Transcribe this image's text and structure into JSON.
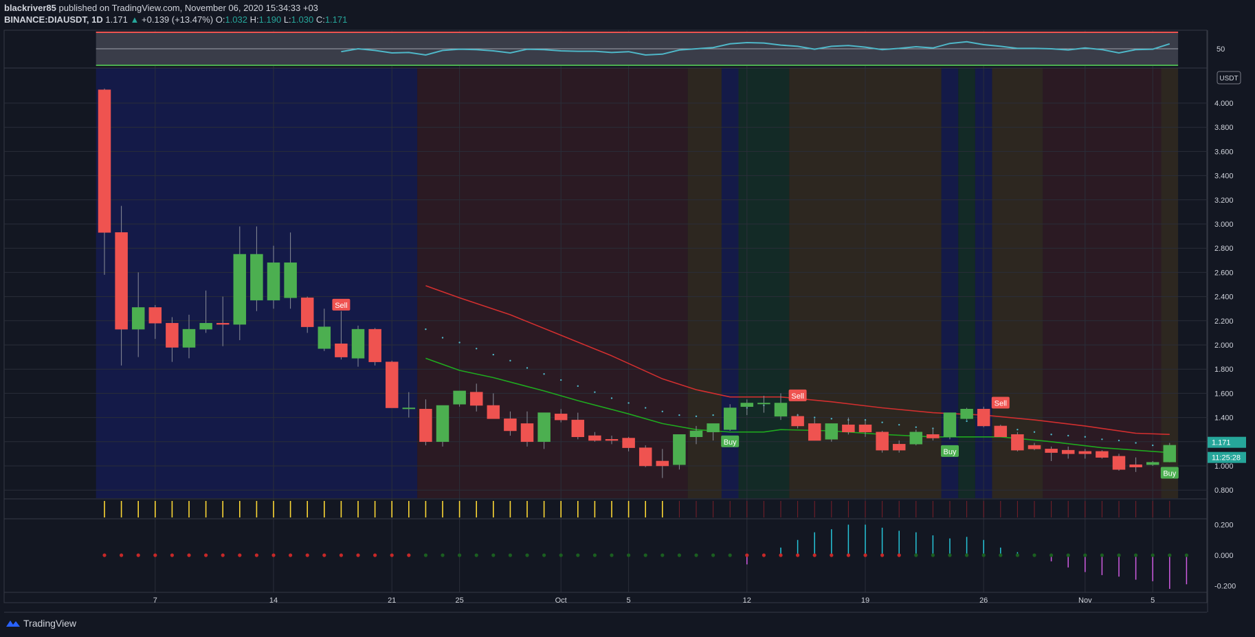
{
  "header": {
    "author": "blackriver85",
    "published_text": "published on TradingView.com, November 06, 2020 15:34:33 +03",
    "symbol": "BINANCE:DIAUSDT, 1D",
    "last": "1.171",
    "change": "+0.139 (+13.47%)",
    "o_label": "O:",
    "o_val": "1.032",
    "h_label": "H:",
    "h_val": "1.190",
    "l_label": "L:",
    "l_val": "1.030",
    "c_label": "C:",
    "c_val": "1.171"
  },
  "footer": {
    "brand": "TradingView"
  },
  "colors": {
    "bull": "#26a69a",
    "bear": "#ef5350",
    "bg": "#131722",
    "grid": "#2a2e39",
    "text": "#d1d4dc"
  },
  "chart_data": {
    "type": "candlestick",
    "currency_label": "USDT",
    "ylim": [
      0.6,
      4.3
    ],
    "y_ticks": [
      "0.800",
      "1.000",
      "1.200",
      "1.400",
      "1.600",
      "1.800",
      "2.000",
      "2.200",
      "2.400",
      "2.600",
      "2.800",
      "3.000",
      "3.200",
      "3.400",
      "3.600",
      "3.800",
      "4.000"
    ],
    "x_labels": [
      {
        "i": 3,
        "label": "7"
      },
      {
        "i": 10,
        "label": "14"
      },
      {
        "i": 17,
        "label": "21"
      },
      {
        "i": 21,
        "label": "25"
      },
      {
        "i": 27,
        "label": "Oct"
      },
      {
        "i": 31,
        "label": "5"
      },
      {
        "i": 38,
        "label": "12"
      },
      {
        "i": 45,
        "label": "19"
      },
      {
        "i": 52,
        "label": "26"
      },
      {
        "i": 58,
        "label": "Nov"
      },
      {
        "i": 62,
        "label": "5"
      }
    ],
    "candles": [
      {
        "o": 4.11,
        "h": 4.12,
        "l": 2.58,
        "c": 2.93
      },
      {
        "o": 2.93,
        "h": 3.15,
        "l": 1.83,
        "c": 2.13
      },
      {
        "o": 2.13,
        "h": 2.6,
        "l": 1.9,
        "c": 2.31
      },
      {
        "o": 2.31,
        "h": 2.33,
        "l": 2.05,
        "c": 2.18
      },
      {
        "o": 2.18,
        "h": 2.23,
        "l": 1.86,
        "c": 1.98
      },
      {
        "o": 1.98,
        "h": 2.25,
        "l": 1.89,
        "c": 2.13
      },
      {
        "o": 2.13,
        "h": 2.45,
        "l": 2.1,
        "c": 2.18
      },
      {
        "o": 2.18,
        "h": 2.4,
        "l": 1.99,
        "c": 2.17
      },
      {
        "o": 2.17,
        "h": 2.98,
        "l": 2.04,
        "c": 2.75
      },
      {
        "o": 2.37,
        "h": 2.98,
        "l": 2.28,
        "c": 2.75
      },
      {
        "o": 2.37,
        "h": 2.82,
        "l": 2.3,
        "c": 2.68
      },
      {
        "o": 2.39,
        "h": 2.93,
        "l": 2.3,
        "c": 2.68
      },
      {
        "o": 2.39,
        "h": 2.4,
        "l": 2.1,
        "c": 2.15
      },
      {
        "o": 1.97,
        "h": 2.3,
        "l": 1.95,
        "c": 2.15
      },
      {
        "o": 2.01,
        "h": 2.28,
        "l": 1.88,
        "c": 1.9
      },
      {
        "o": 1.89,
        "h": 2.16,
        "l": 1.82,
        "c": 2.13
      },
      {
        "o": 2.13,
        "h": 2.14,
        "l": 1.83,
        "c": 1.86
      },
      {
        "o": 1.86,
        "h": 1.87,
        "l": 1.48,
        "c": 1.48
      },
      {
        "o": 1.48,
        "h": 1.61,
        "l": 1.4,
        "c": 1.48
      },
      {
        "o": 1.47,
        "h": 1.55,
        "l": 1.17,
        "c": 1.2
      },
      {
        "o": 1.2,
        "h": 1.5,
        "l": 1.16,
        "c": 1.5
      },
      {
        "o": 1.51,
        "h": 1.62,
        "l": 1.49,
        "c": 1.62
      },
      {
        "o": 1.61,
        "h": 1.68,
        "l": 1.45,
        "c": 1.5
      },
      {
        "o": 1.5,
        "h": 1.6,
        "l": 1.4,
        "c": 1.39
      },
      {
        "o": 1.39,
        "h": 1.45,
        "l": 1.25,
        "c": 1.29
      },
      {
        "o": 1.35,
        "h": 1.45,
        "l": 1.16,
        "c": 1.2
      },
      {
        "o": 1.2,
        "h": 1.44,
        "l": 1.14,
        "c": 1.44
      },
      {
        "o": 1.43,
        "h": 1.47,
        "l": 1.36,
        "c": 1.38
      },
      {
        "o": 1.38,
        "h": 1.44,
        "l": 1.22,
        "c": 1.24
      },
      {
        "o": 1.25,
        "h": 1.28,
        "l": 1.2,
        "c": 1.21
      },
      {
        "o": 1.22,
        "h": 1.25,
        "l": 1.18,
        "c": 1.21
      },
      {
        "o": 1.23,
        "h": 1.24,
        "l": 1.12,
        "c": 1.15
      },
      {
        "o": 1.15,
        "h": 1.17,
        "l": 0.99,
        "c": 1.0
      },
      {
        "o": 1.04,
        "h": 1.14,
        "l": 0.9,
        "c": 1.0
      },
      {
        "o": 1.01,
        "h": 1.26,
        "l": 0.97,
        "c": 1.26
      },
      {
        "o": 1.24,
        "h": 1.33,
        "l": 1.18,
        "c": 1.29
      },
      {
        "o": 1.28,
        "h": 1.35,
        "l": 1.21,
        "c": 1.35
      },
      {
        "o": 1.3,
        "h": 1.51,
        "l": 1.29,
        "c": 1.48
      },
      {
        "o": 1.49,
        "h": 1.55,
        "l": 1.42,
        "c": 1.52
      },
      {
        "o": 1.52,
        "h": 1.58,
        "l": 1.44,
        "c": 1.52
      },
      {
        "o": 1.41,
        "h": 1.6,
        "l": 1.38,
        "c": 1.52
      },
      {
        "o": 1.41,
        "h": 1.43,
        "l": 1.31,
        "c": 1.33
      },
      {
        "o": 1.35,
        "h": 1.39,
        "l": 1.21,
        "c": 1.21
      },
      {
        "o": 1.22,
        "h": 1.35,
        "l": 1.2,
        "c": 1.35
      },
      {
        "o": 1.34,
        "h": 1.4,
        "l": 1.26,
        "c": 1.28
      },
      {
        "o": 1.34,
        "h": 1.38,
        "l": 1.24,
        "c": 1.28
      },
      {
        "o": 1.28,
        "h": 1.29,
        "l": 1.11,
        "c": 1.13
      },
      {
        "o": 1.18,
        "h": 1.21,
        "l": 1.11,
        "c": 1.13
      },
      {
        "o": 1.18,
        "h": 1.3,
        "l": 1.17,
        "c": 1.28
      },
      {
        "o": 1.26,
        "h": 1.31,
        "l": 1.21,
        "c": 1.23
      },
      {
        "o": 1.24,
        "h": 1.44,
        "l": 1.22,
        "c": 1.44
      },
      {
        "o": 1.39,
        "h": 1.48,
        "l": 1.38,
        "c": 1.47
      },
      {
        "o": 1.47,
        "h": 1.49,
        "l": 1.32,
        "c": 1.33
      },
      {
        "o": 1.33,
        "h": 1.34,
        "l": 1.24,
        "c": 1.24
      },
      {
        "o": 1.26,
        "h": 1.28,
        "l": 1.12,
        "c": 1.13
      },
      {
        "o": 1.17,
        "h": 1.19,
        "l": 1.13,
        "c": 1.14
      },
      {
        "o": 1.14,
        "h": 1.16,
        "l": 1.04,
        "c": 1.11
      },
      {
        "o": 1.13,
        "h": 1.16,
        "l": 1.06,
        "c": 1.1
      },
      {
        "o": 1.12,
        "h": 1.14,
        "l": 1.06,
        "c": 1.1
      },
      {
        "o": 1.12,
        "h": 1.13,
        "l": 1.06,
        "c": 1.07
      },
      {
        "o": 1.08,
        "h": 1.1,
        "l": 0.96,
        "c": 0.97
      },
      {
        "o": 1.01,
        "h": 1.07,
        "l": 0.95,
        "c": 0.99
      },
      {
        "o": 1.01,
        "h": 1.04,
        "l": 1.0,
        "c": 1.03
      },
      {
        "o": 1.032,
        "h": 1.19,
        "l": 1.03,
        "c": 1.171
      }
    ],
    "sma_red": [
      [
        19,
        2.49
      ],
      [
        21,
        2.39
      ],
      [
        24,
        2.25
      ],
      [
        27,
        2.08
      ],
      [
        30,
        1.91
      ],
      [
        33,
        1.72
      ],
      [
        35,
        1.63
      ],
      [
        37,
        1.57
      ],
      [
        40,
        1.57
      ],
      [
        43,
        1.53
      ],
      [
        46,
        1.48
      ],
      [
        49,
        1.44
      ],
      [
        52,
        1.42
      ],
      [
        55,
        1.38
      ],
      [
        58,
        1.33
      ],
      [
        61,
        1.27
      ],
      [
        63,
        1.26
      ]
    ],
    "sma_green": [
      [
        19,
        1.89
      ],
      [
        21,
        1.79
      ],
      [
        23,
        1.73
      ],
      [
        26,
        1.62
      ],
      [
        28,
        1.54
      ],
      [
        31,
        1.43
      ],
      [
        33,
        1.35
      ],
      [
        35,
        1.3
      ],
      [
        37,
        1.28
      ],
      [
        39,
        1.28
      ],
      [
        40,
        1.3
      ],
      [
        43,
        1.29
      ],
      [
        46,
        1.26
      ],
      [
        49,
        1.24
      ],
      [
        53,
        1.24
      ],
      [
        56,
        1.2
      ],
      [
        59,
        1.15
      ],
      [
        62,
        1.12
      ],
      [
        63,
        1.11
      ]
    ],
    "psar": [
      [
        19,
        2.13
      ],
      [
        20,
        2.06
      ],
      [
        21,
        2.02
      ],
      [
        22,
        1.97
      ],
      [
        23,
        1.92
      ],
      [
        24,
        1.87
      ],
      [
        25,
        1.81
      ],
      [
        26,
        1.76
      ],
      [
        27,
        1.71
      ],
      [
        28,
        1.66
      ],
      [
        29,
        1.61
      ],
      [
        30,
        1.56
      ],
      [
        31,
        1.52
      ],
      [
        32,
        1.48
      ],
      [
        33,
        1.45
      ],
      [
        34,
        1.42
      ],
      [
        35,
        1.41
      ],
      [
        36,
        1.42
      ],
      [
        37,
        1.44
      ],
      [
        38,
        1.48
      ],
      [
        39,
        1.5
      ],
      [
        40,
        1.44
      ],
      [
        41,
        1.42
      ],
      [
        42,
        1.4
      ],
      [
        43,
        1.39
      ],
      [
        44,
        1.38
      ],
      [
        45,
        1.38
      ],
      [
        46,
        1.36
      ],
      [
        47,
        1.34
      ],
      [
        48,
        1.32
      ],
      [
        49,
        1.31
      ],
      [
        50,
        1.34
      ],
      [
        51,
        1.37
      ],
      [
        52,
        1.4
      ],
      [
        53,
        1.32
      ],
      [
        54,
        1.3
      ],
      [
        55,
        1.28
      ],
      [
        56,
        1.26
      ],
      [
        57,
        1.25
      ],
      [
        58,
        1.24
      ],
      [
        59,
        1.22
      ],
      [
        60,
        1.21
      ],
      [
        61,
        1.19
      ],
      [
        62,
        1.17
      ],
      [
        63,
        1.15
      ]
    ],
    "signals": [
      {
        "i": 14,
        "type": "Sell",
        "price": 2.33
      },
      {
        "i": 37,
        "type": "Buy",
        "price": 1.2
      },
      {
        "i": 41,
        "type": "Sell",
        "price": 1.58
      },
      {
        "i": 50,
        "type": "Buy",
        "price": 1.12
      },
      {
        "i": 53,
        "type": "Sell",
        "price": 1.52
      },
      {
        "i": 63,
        "type": "Buy",
        "price": 0.94
      }
    ],
    "price_tags": [
      {
        "label": "1.171",
        "price": 1.195,
        "color": "#26a69a"
      },
      {
        "label": "11:25:28",
        "price": 1.07,
        "color": "#26a69a"
      }
    ],
    "bg_zones": [
      {
        "from": -0.5,
        "to": 18.5,
        "color": "#141a48"
      },
      {
        "from": 18.5,
        "to": 34.5,
        "color": "#2b1a23"
      },
      {
        "from": 34.5,
        "to": 36.5,
        "color": "#2d2720"
      },
      {
        "from": 36.5,
        "to": 37.5,
        "color": "#141a48"
      },
      {
        "from": 37.5,
        "to": 40.5,
        "color": "#132a26"
      },
      {
        "from": 40.5,
        "to": 49.5,
        "color": "#2d2720"
      },
      {
        "from": 49.5,
        "to": 50.5,
        "color": "#141a48"
      },
      {
        "from": 50.5,
        "to": 51.5,
        "color": "#132a26"
      },
      {
        "from": 51.5,
        "to": 52.5,
        "color": "#141a48"
      },
      {
        "from": 52.5,
        "to": 55.5,
        "color": "#2d2720"
      },
      {
        "from": 55.5,
        "to": 62.5,
        "color": "#2b1a23"
      },
      {
        "from": 62.5,
        "to": 63.5,
        "color": "#2d2720"
      }
    ],
    "rsi": {
      "y_tick": "50",
      "values": [
        [
          14,
          43
        ],
        [
          15,
          50
        ],
        [
          16,
          46
        ],
        [
          17,
          40
        ],
        [
          18,
          41
        ],
        [
          19,
          35
        ],
        [
          20,
          46
        ],
        [
          21,
          49
        ],
        [
          22,
          48
        ],
        [
          23,
          45
        ],
        [
          24,
          40
        ],
        [
          25,
          49
        ],
        [
          26,
          48
        ],
        [
          27,
          45
        ],
        [
          28,
          44
        ],
        [
          29,
          44
        ],
        [
          30,
          41
        ],
        [
          31,
          43
        ],
        [
          32,
          35
        ],
        [
          33,
          37
        ],
        [
          34,
          47
        ],
        [
          35,
          50
        ],
        [
          36,
          53
        ],
        [
          37,
          62
        ],
        [
          38,
          65
        ],
        [
          39,
          64
        ],
        [
          40,
          59
        ],
        [
          41,
          56
        ],
        [
          42,
          49
        ],
        [
          43,
          56
        ],
        [
          44,
          58
        ],
        [
          45,
          54
        ],
        [
          46,
          48
        ],
        [
          47,
          51
        ],
        [
          48,
          55
        ],
        [
          49,
          52
        ],
        [
          50,
          63
        ],
        [
          51,
          67
        ],
        [
          52,
          60
        ],
        [
          53,
          56
        ],
        [
          54,
          51
        ],
        [
          55,
          51
        ],
        [
          56,
          50
        ],
        [
          57,
          47
        ],
        [
          58,
          52
        ],
        [
          59,
          48
        ],
        [
          60,
          40
        ],
        [
          61,
          48
        ],
        [
          62,
          49
        ],
        [
          63,
          62
        ]
      ]
    },
    "strip_bar_count": 64,
    "strip_yellow_until": 33,
    "osc": {
      "y_ticks": [
        "0.200",
        "0.000",
        "-0.200"
      ],
      "ylim": [
        -0.24,
        0.22
      ],
      "values": [
        0,
        0,
        0,
        0,
        0,
        0,
        0,
        0,
        0,
        0,
        0,
        0,
        0,
        0,
        0,
        0,
        0,
        0,
        0,
        0,
        0,
        0,
        0,
        0,
        0,
        0,
        0,
        0,
        0,
        0,
        0,
        0,
        0,
        0,
        0,
        0,
        0,
        0,
        -0.06,
        0,
        0.05,
        0.1,
        0.15,
        0.17,
        0.2,
        0.2,
        0.18,
        0.16,
        0.15,
        0.13,
        0.11,
        0.12,
        0.1,
        0.05,
        0.02,
        0,
        -0.04,
        -0.08,
        -0.11,
        -0.13,
        -0.14,
        -0.16,
        -0.17,
        -0.22,
        -0.19
      ],
      "dot_red_until": 19,
      "dot_green_from": 19,
      "dot_red_from2": 38,
      "dot_red_to2": 47
    }
  }
}
